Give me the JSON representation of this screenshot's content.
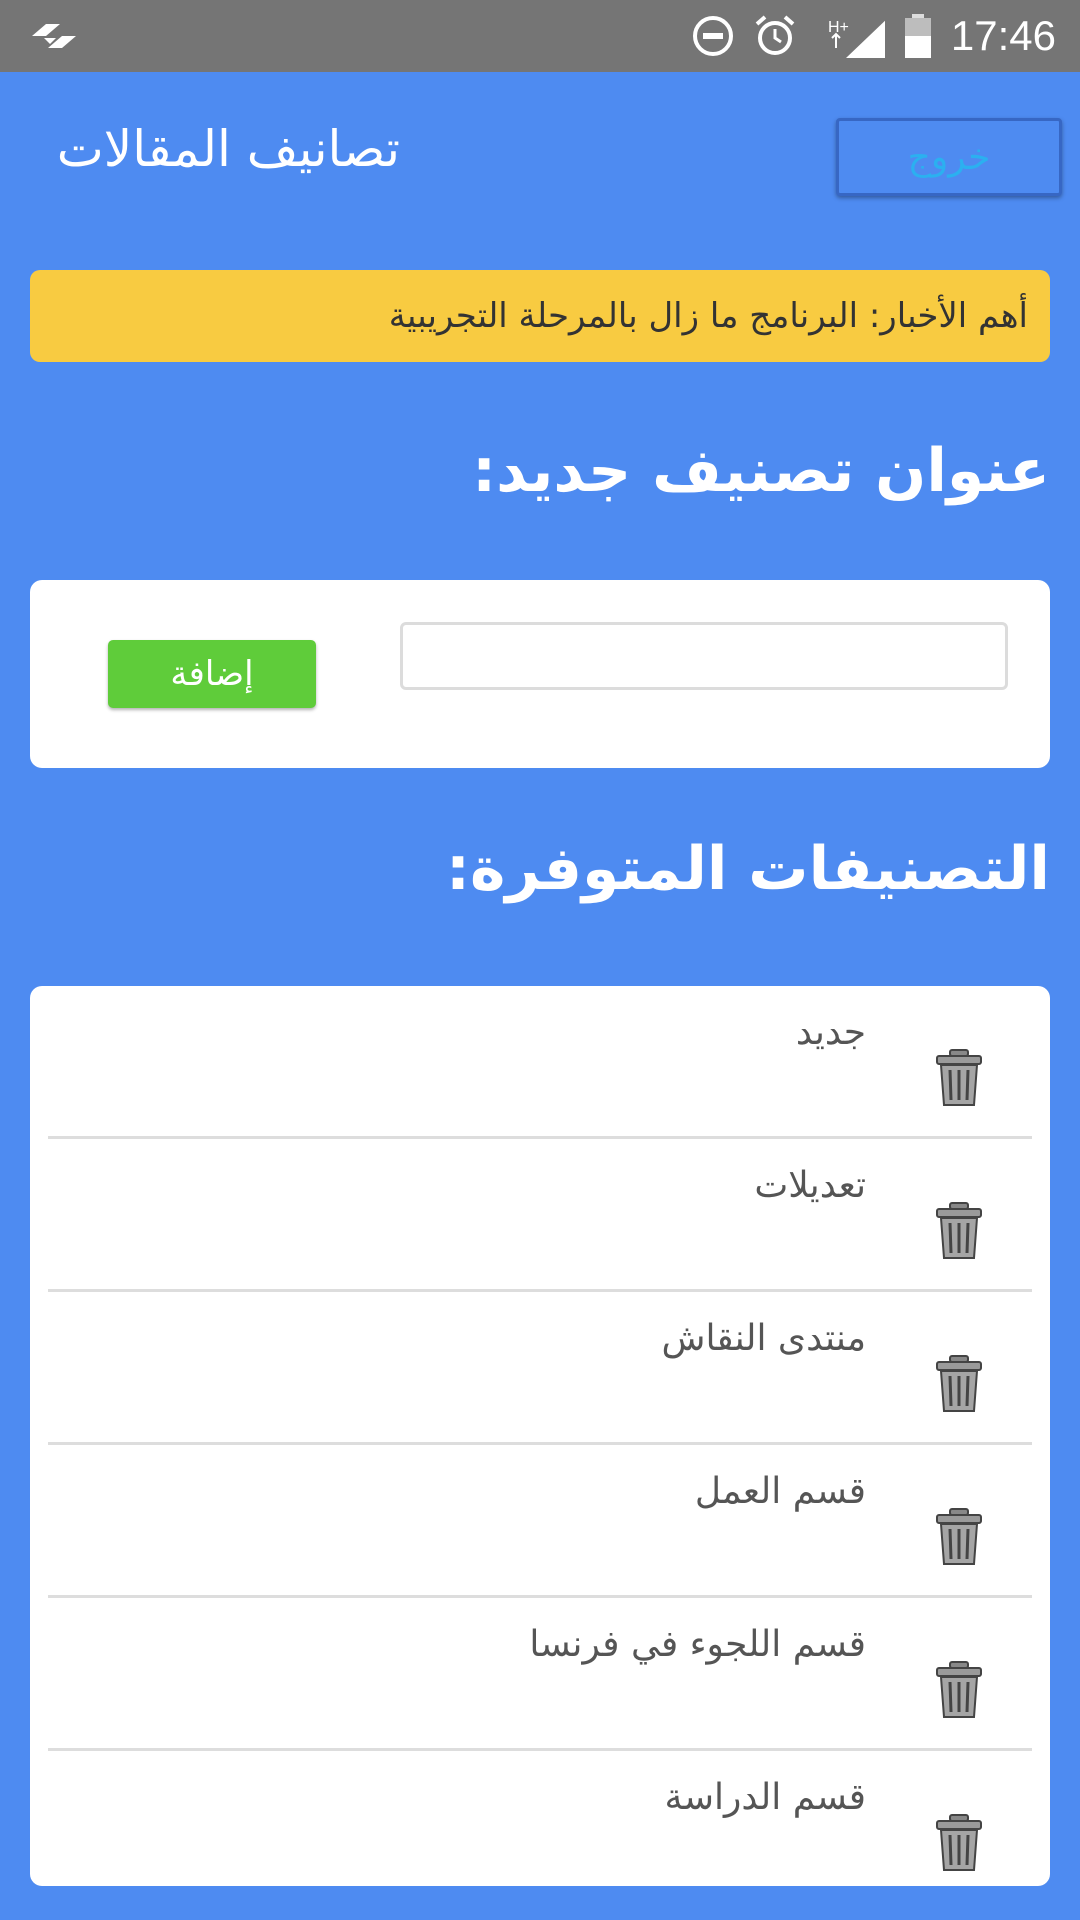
{
  "status_bar": {
    "time": "17:46",
    "icons": [
      "transfer-icon",
      "dnd-icon",
      "alarm-icon",
      "network-hplus-icon",
      "signal-icon",
      "battery-icon"
    ]
  },
  "header": {
    "title": "تصانيف المقالات",
    "logout_label": "خروج"
  },
  "news": {
    "text": "أهم الأخبار: البرنامج ما زال بالمرحلة التجريبية"
  },
  "new_category": {
    "heading": "عنوان تصنيف جديد:",
    "input_value": "",
    "add_label": "إضافة"
  },
  "available": {
    "heading": "التصنيفات المتوفرة:",
    "items": [
      {
        "label": "جديد"
      },
      {
        "label": "تعديلات"
      },
      {
        "label": "منتدى النقاش"
      },
      {
        "label": "قسم العمل"
      },
      {
        "label": "قسم اللجوء في فرنسا"
      },
      {
        "label": "قسم الدراسة"
      }
    ]
  },
  "colors": {
    "background": "#4e8bf1",
    "status_bar": "#757575",
    "news_bar": "#f8cb41",
    "add_button": "#5fcc3a",
    "logout_text": "#2bb0f0"
  }
}
